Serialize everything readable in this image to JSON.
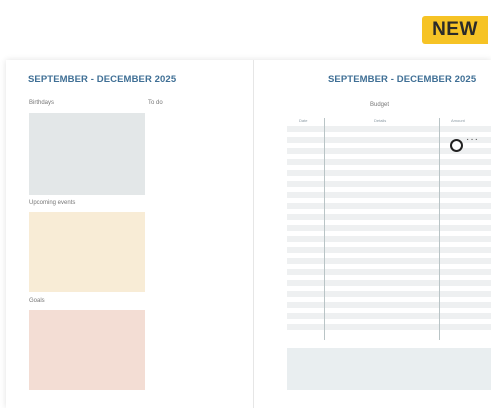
{
  "badge": {
    "label": "NEW"
  },
  "left_page": {
    "title": "SEPTEMBER - DECEMBER 2025",
    "birthdays_label": "Birthdays",
    "todo_label": "To do",
    "upcoming_label": "Upcoming events",
    "goals_label": "Goals"
  },
  "right_page": {
    "title": "SEPTEMBER - DECEMBER 2025",
    "budget_label": "Budget",
    "columns": [
      "Date",
      "Details",
      "Amount"
    ]
  },
  "colors": {
    "title_blue": "#3f6f95",
    "badge_yellow": "#f6c325",
    "birthdays_block": "#e3e7e8",
    "upcoming_block": "#f8ecd6",
    "goals_block": "#f3ddd4"
  }
}
